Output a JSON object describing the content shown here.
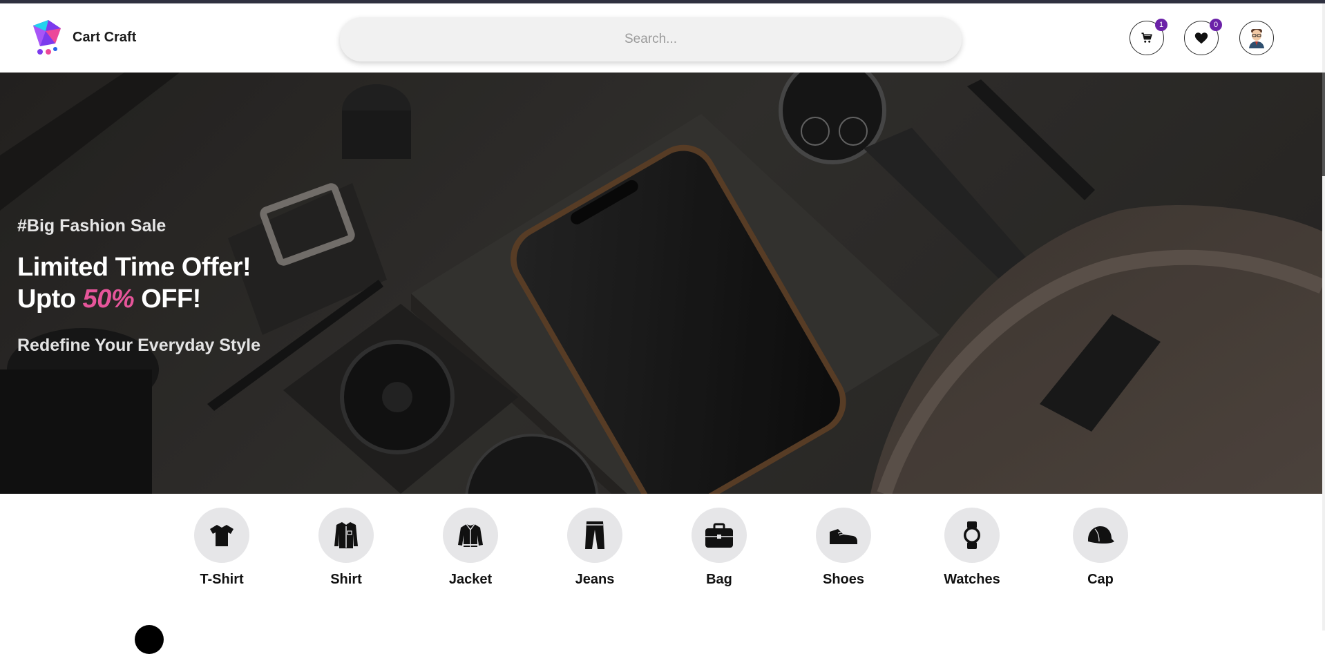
{
  "header": {
    "brand": "Cart Craft",
    "search_placeholder": "Search...",
    "cart_count": "1",
    "wishlist_count": "0"
  },
  "hero": {
    "tag": "#Big Fashion Sale",
    "line1": "Limited Time Offer!",
    "line2_prefix": "Upto ",
    "line2_highlight": "50%",
    "line2_suffix": " OFF!",
    "subline": "Redefine Your Everyday Style"
  },
  "categories": [
    {
      "label": "T-Shirt",
      "icon": "tshirt-icon"
    },
    {
      "label": "Shirt",
      "icon": "shirt-icon"
    },
    {
      "label": "Jacket",
      "icon": "jacket-icon"
    },
    {
      "label": "Jeans",
      "icon": "jeans-icon"
    },
    {
      "label": "Bag",
      "icon": "bag-icon"
    },
    {
      "label": "Shoes",
      "icon": "shoes-icon"
    },
    {
      "label": "Watches",
      "icon": "watch-icon"
    },
    {
      "label": "Cap",
      "icon": "cap-icon"
    }
  ],
  "colors": {
    "accent": "#6b21a8",
    "highlight": "#e6559a"
  }
}
